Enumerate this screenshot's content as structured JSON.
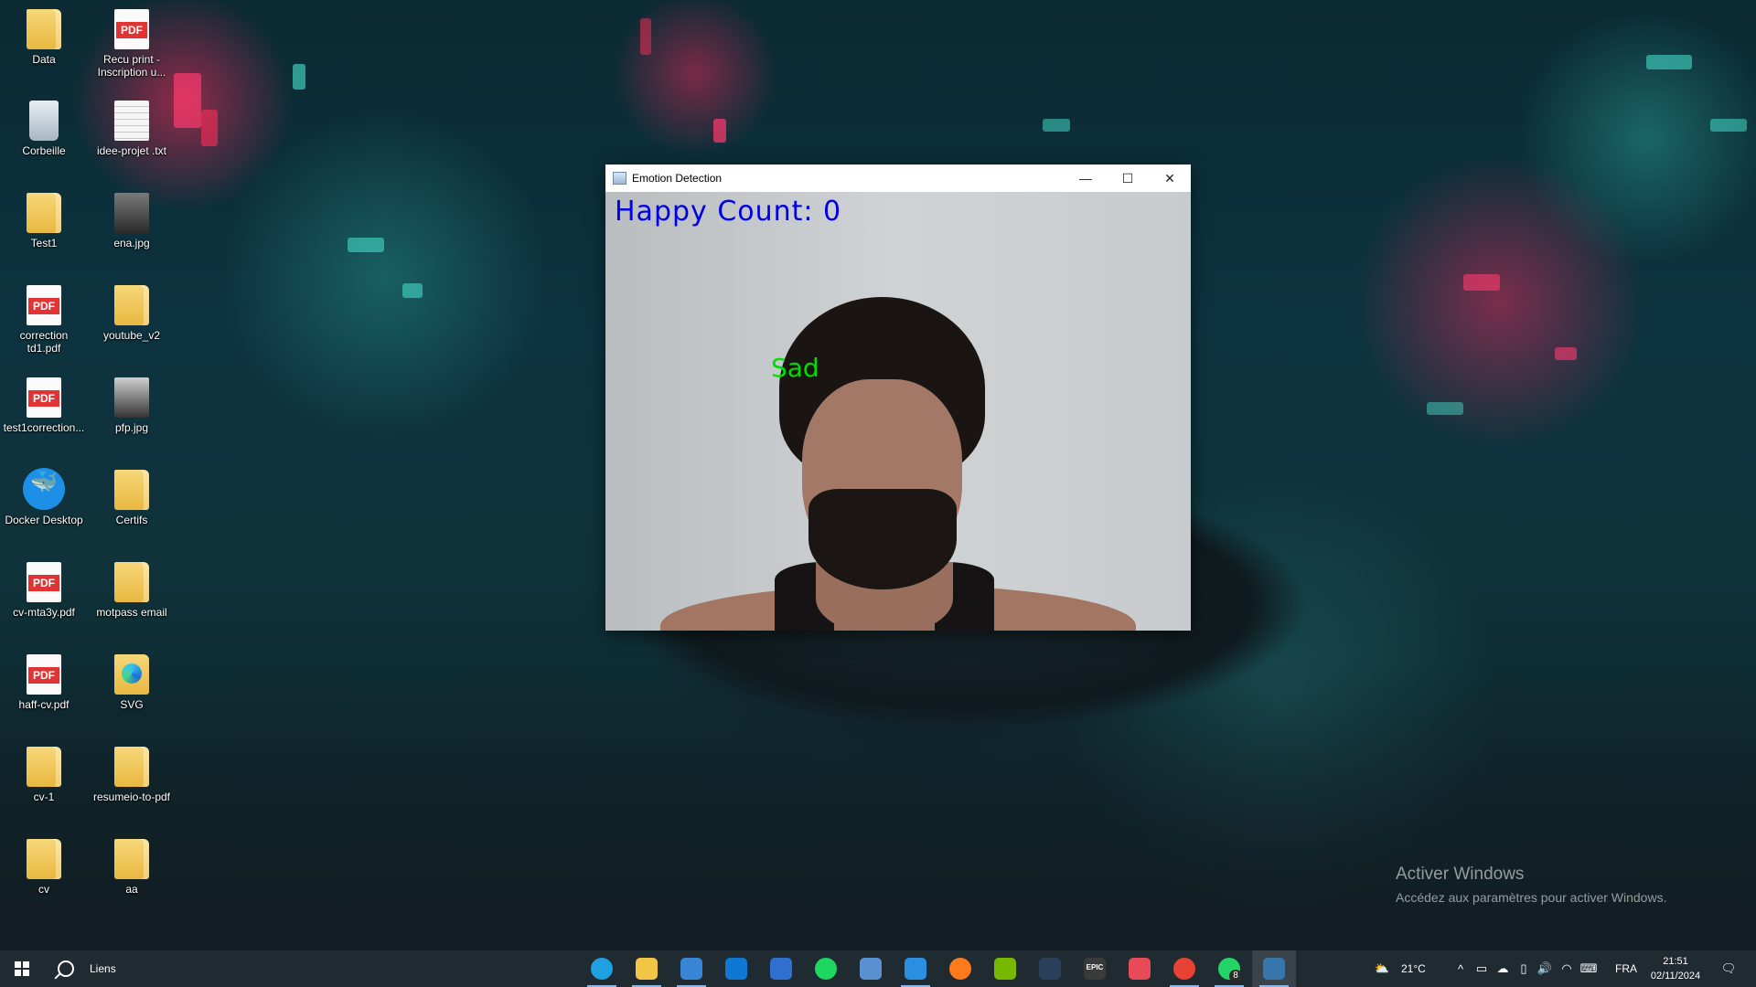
{
  "desktop": {
    "icons": [
      {
        "label": "Data",
        "icon": "folder-icon"
      },
      {
        "label": "Recu print - Inscription u...",
        "icon": "pdf-icon"
      },
      {
        "label": "Corbeille",
        "icon": "recycle-bin-icon"
      },
      {
        "label": "idee-projet .txt",
        "icon": "text-file-icon"
      },
      {
        "label": "Test1",
        "icon": "folder-icon"
      },
      {
        "label": "ena.jpg",
        "icon": "image-icon"
      },
      {
        "label": "correction td1.pdf",
        "icon": "pdf-icon"
      },
      {
        "label": "youtube_v2",
        "icon": "folder-icon"
      },
      {
        "label": "test1correction...",
        "icon": "pdf-icon"
      },
      {
        "label": "pfp.jpg",
        "icon": "image-icon"
      },
      {
        "label": "Docker Desktop",
        "icon": "docker-icon"
      },
      {
        "label": "Certifs",
        "icon": "folder-icon"
      },
      {
        "label": "cv-mta3y.pdf",
        "icon": "pdf-icon"
      },
      {
        "label": "motpass email",
        "icon": "folder-icon"
      },
      {
        "label": "haff-cv.pdf",
        "icon": "pdf-icon"
      },
      {
        "label": "SVG",
        "icon": "folder-icon"
      },
      {
        "label": "cv-1",
        "icon": "folder-icon"
      },
      {
        "label": "resumeio-to-pdf",
        "icon": "folder-icon"
      },
      {
        "label": "cv",
        "icon": "folder-icon"
      },
      {
        "label": "aa",
        "icon": "folder-icon"
      }
    ],
    "pdf_tag": "PDF"
  },
  "window": {
    "title": "Emotion Detection",
    "minimize": "—",
    "maximize": "☐",
    "close": "✕",
    "overlay_count": "Happy Count: 0",
    "overlay_label": "Sad",
    "count_color": "#0000e6",
    "label_color": "#00dd00"
  },
  "watermark": {
    "line1": "Activer Windows",
    "line2": "Accédez aux paramètres pour activer Windows."
  },
  "taskbar": {
    "search_label": "Liens",
    "apps": [
      {
        "name": "edge-icon",
        "color": "#1fa0e0"
      },
      {
        "name": "file-explorer-icon",
        "color": "#f2c545"
      },
      {
        "name": "microsoft-store-icon",
        "color": "#3a86d6"
      },
      {
        "name": "outlook-icon",
        "color": "#0f78d4"
      },
      {
        "name": "app-installer-icon",
        "color": "#2f6fd0"
      },
      {
        "name": "spotify-icon",
        "color": "#1ed760"
      },
      {
        "name": "app-icon",
        "color": "#5a8fd0"
      },
      {
        "name": "vscode-icon",
        "color": "#2a8fe0"
      },
      {
        "name": "firefox-icon",
        "color": "#ff7a1a"
      },
      {
        "name": "nvidia-icon",
        "color": "#76b900"
      },
      {
        "name": "steam-icon",
        "color": "#2a3f5a"
      },
      {
        "name": "epic-games-icon",
        "color": "#3a3a3a"
      },
      {
        "name": "valorant-icon",
        "color": "#e84a5a"
      },
      {
        "name": "chrome-icon",
        "color": "#e94235"
      },
      {
        "name": "whatsapp-icon",
        "color": "#25d366"
      },
      {
        "name": "python-icon",
        "color": "#3776ab"
      }
    ],
    "whatsapp_badge": "8",
    "epic_text": "EPIC",
    "weather": "21°C",
    "language": "FRA",
    "time": "21:51",
    "date": "02/11/2024"
  }
}
